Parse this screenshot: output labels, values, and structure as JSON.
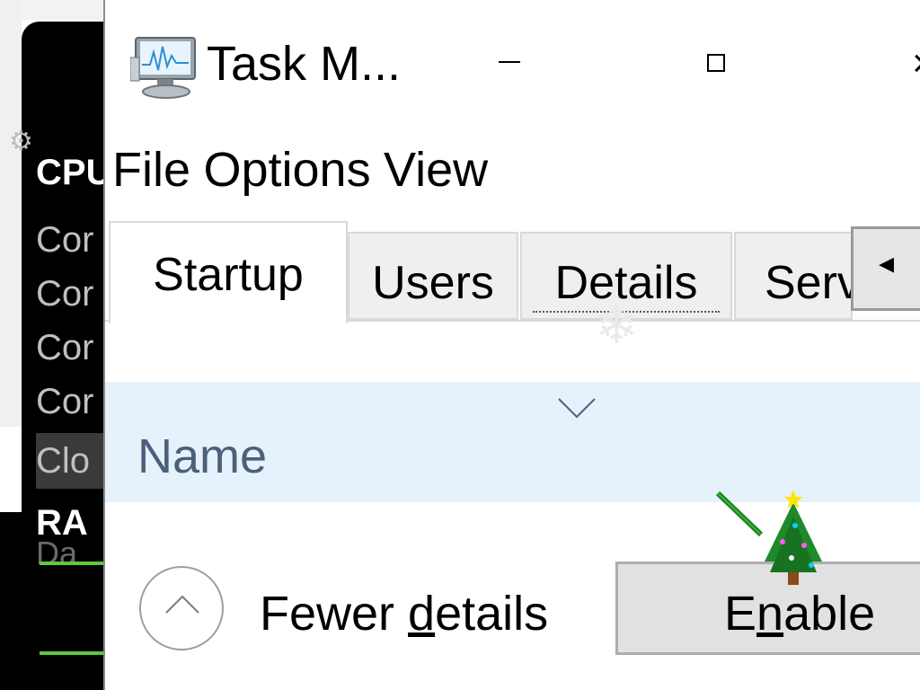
{
  "window": {
    "title": "Task M...",
    "controls": {
      "minimize": "–",
      "maximize": "□",
      "close": "×"
    }
  },
  "menubar": {
    "items": [
      "File",
      "Options",
      "View"
    ]
  },
  "tabs": [
    {
      "label": "Startup",
      "selected": true
    },
    {
      "label": "Users",
      "selected": false
    },
    {
      "label": "Details",
      "selected": false
    },
    {
      "label": "Serv",
      "selected": false
    }
  ],
  "tab_scroll_icon": "caret-left",
  "table": {
    "columns": [
      "Name"
    ],
    "sort_indicator": "chevron-down"
  },
  "footer": {
    "fewer_details_pre": "Fewer ",
    "fewer_details_underlined": "d",
    "fewer_details_post": "etails",
    "enable_pre": "E",
    "enable_underlined": "n",
    "enable_post": "able"
  },
  "background_window": {
    "items": [
      "CPU",
      "Cor",
      "Cor",
      "Cor",
      "Cor",
      "Clo",
      "RA",
      "Da"
    ]
  },
  "colors": {
    "header_bg": "#e5f1fb",
    "header_text": "#4c607a",
    "button_bg": "#e1e1e1",
    "bg_green": "#5fc83b"
  },
  "icons": [
    "task-manager-icon",
    "minimize-icon",
    "maximize-icon",
    "close-icon",
    "caret-left-icon",
    "chevron-down-icon",
    "chevron-up-icon",
    "gear-icon",
    "christmas-tree-icon"
  ]
}
